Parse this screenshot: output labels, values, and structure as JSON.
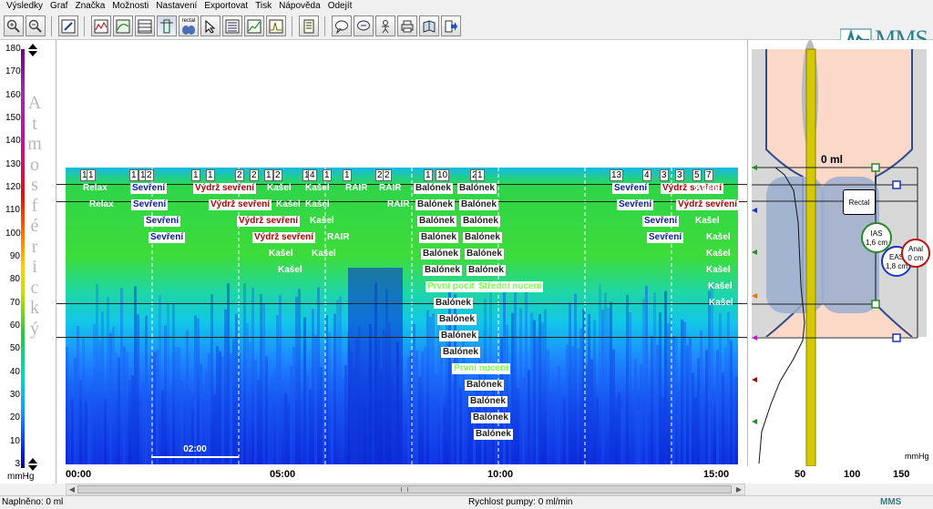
{
  "menu": [
    "Výsledky",
    "Graf",
    "Značka",
    "Možnosti",
    "Nastavení",
    "Exportovat",
    "Tisk",
    "Nápověda",
    "Odejít"
  ],
  "toolbar": {
    "buttons": [
      "zoom-in-icon",
      "zoom-out-icon",
      "edit-icon",
      "waveform-icon",
      "curve-icon",
      "table-icon",
      "ruler-icon",
      "rectal-icon",
      "pointer-icon",
      "list-icon",
      "chart-icon",
      "chart-alt-icon",
      "document-icon",
      "comment-icon",
      "comment-alt-icon",
      "figure-icon",
      "print-icon",
      "book-icon",
      "export-icon"
    ],
    "rectal_label": "rectal"
  },
  "logo": {
    "text": "MMS"
  },
  "yaxis": {
    "ticks": [
      "180",
      "170",
      "160",
      "150",
      "140",
      "130",
      "120",
      "110",
      "100",
      "90",
      "80",
      "70",
      "60",
      "50",
      "40",
      "30",
      "20",
      "10",
      "3"
    ],
    "title_letters": [
      "A",
      "t",
      "m",
      "o",
      "s",
      "f",
      "é",
      "r",
      "i",
      "c",
      "k",
      "ý"
    ],
    "unit": "mmHg"
  },
  "plot": {
    "scale_bar": "02:00",
    "value_label": "0 ml",
    "markers": [
      {
        "t": "1",
        "x": 16,
        "y": 142
      },
      {
        "t": "1",
        "x": 23,
        "y": 142
      },
      {
        "t": "1",
        "x": 70,
        "y": 142
      },
      {
        "t": "1",
        "x": 80,
        "y": 142
      },
      {
        "t": "2",
        "x": 87,
        "y": 142
      },
      {
        "t": "1",
        "x": 138,
        "y": 142
      },
      {
        "t": "1",
        "x": 154,
        "y": 142
      },
      {
        "t": "2",
        "x": 186,
        "y": 142
      },
      {
        "t": "2",
        "x": 202,
        "y": 142
      },
      {
        "t": "1",
        "x": 218,
        "y": 142
      },
      {
        "t": "2",
        "x": 228,
        "y": 142
      },
      {
        "t": "1",
        "x": 260,
        "y": 142
      },
      {
        "t": "4",
        "x": 266,
        "y": 142
      },
      {
        "t": "1",
        "x": 282,
        "y": 142
      },
      {
        "t": "1",
        "x": 304,
        "y": 142
      },
      {
        "t": "2",
        "x": 340,
        "y": 142
      },
      {
        "t": "2",
        "x": 348,
        "y": 142
      },
      {
        "t": "1",
        "x": 393,
        "y": 142
      },
      {
        "t": "10",
        "x": 406,
        "y": 142
      },
      {
        "t": "2",
        "x": 444,
        "y": 142
      },
      {
        "t": "1",
        "x": 450,
        "y": 142
      },
      {
        "t": "13",
        "x": 597,
        "y": 142
      },
      {
        "t": "4",
        "x": 633,
        "y": 142
      },
      {
        "t": "3",
        "x": 652,
        "y": 142
      },
      {
        "t": "3",
        "x": 669,
        "y": 142
      },
      {
        "t": "5",
        "x": 688,
        "y": 142
      },
      {
        "t": "7",
        "x": 701,
        "y": 142
      }
    ],
    "labels": [
      {
        "t": "Relax",
        "c": "white",
        "x": 17,
        "y": 157
      },
      {
        "t": "Relax",
        "c": "white",
        "x": 24,
        "y": 175
      },
      {
        "t": "Sevření",
        "c": "blue",
        "x": 71,
        "y": 157
      },
      {
        "t": "Sevření",
        "c": "blue",
        "x": 72,
        "y": 175
      },
      {
        "t": "Sevření",
        "c": "blue",
        "x": 86,
        "y": 193
      },
      {
        "t": "Sevření",
        "c": "blue",
        "x": 91,
        "y": 211
      },
      {
        "t": "Výdrž sevření",
        "c": "red",
        "x": 140,
        "y": 157
      },
      {
        "t": "Výdrž sevření",
        "c": "red",
        "x": 157,
        "y": 175
      },
      {
        "t": "Výdrž sevření",
        "c": "red",
        "x": 188,
        "y": 193
      },
      {
        "t": "Výdrž sevření",
        "c": "red",
        "x": 205,
        "y": 211
      },
      {
        "t": "Kašel",
        "c": "white",
        "x": 219,
        "y": 157
      },
      {
        "t": "Kašel",
        "c": "white",
        "x": 229,
        "y": 175
      },
      {
        "t": "Kašel",
        "c": "white",
        "x": 221,
        "y": 229
      },
      {
        "t": "Kašel",
        "c": "white",
        "x": 231,
        "y": 247
      },
      {
        "t": "Kašel",
        "c": "white",
        "x": 261,
        "y": 157
      },
      {
        "t": "Kašel",
        "c": "white",
        "x": 261,
        "y": 175
      },
      {
        "t": "Kašel",
        "c": "white",
        "x": 266,
        "y": 193
      },
      {
        "t": "Kašel",
        "c": "white",
        "x": 268,
        "y": 229
      },
      {
        "t": "RAIR",
        "c": "white",
        "x": 305,
        "y": 157
      },
      {
        "t": "RAIR",
        "c": "white",
        "x": 285,
        "y": 211
      },
      {
        "t": "RAIR",
        "c": "white",
        "x": 342,
        "y": 157
      },
      {
        "t": "RAIR",
        "c": "white",
        "x": 351,
        "y": 175
      },
      {
        "t": "Balónek",
        "c": "dark",
        "x": 382,
        "y": 157
      },
      {
        "t": "Balónek",
        "c": "dark",
        "x": 384,
        "y": 175
      },
      {
        "t": "Balónek",
        "c": "dark",
        "x": 386,
        "y": 193
      },
      {
        "t": "Balónek",
        "c": "dark",
        "x": 388,
        "y": 211
      },
      {
        "t": "Balónek",
        "c": "dark",
        "x": 390,
        "y": 229
      },
      {
        "t": "Balónek",
        "c": "dark",
        "x": 392,
        "y": 247
      },
      {
        "t": "První pocit",
        "c": "green",
        "x": 395,
        "y": 265
      },
      {
        "t": "Balónek",
        "c": "dark",
        "x": 404,
        "y": 283
      },
      {
        "t": "Balónek",
        "c": "dark",
        "x": 408,
        "y": 301
      },
      {
        "t": "Balónek",
        "c": "dark",
        "x": 410,
        "y": 319
      },
      {
        "t": "Balónek",
        "c": "dark",
        "x": 412,
        "y": 337
      },
      {
        "t": "První nucení",
        "c": "green",
        "x": 424,
        "y": 355
      },
      {
        "t": "Balónek",
        "c": "dark",
        "x": 438,
        "y": 373
      },
      {
        "t": "Balónek",
        "c": "dark",
        "x": 442,
        "y": 391
      },
      {
        "t": "Balónek",
        "c": "dark",
        "x": 445,
        "y": 409
      },
      {
        "t": "Balónek",
        "c": "dark",
        "x": 448,
        "y": 427
      },
      {
        "t": "Balónek",
        "c": "dark",
        "x": 430,
        "y": 157
      },
      {
        "t": "Balónek",
        "c": "dark",
        "x": 432,
        "y": 175
      },
      {
        "t": "Balónek",
        "c": "dark",
        "x": 434,
        "y": 193
      },
      {
        "t": "Balónek",
        "c": "dark",
        "x": 436,
        "y": 211
      },
      {
        "t": "Balónek",
        "c": "dark",
        "x": 438,
        "y": 229
      },
      {
        "t": "Balónek",
        "c": "dark",
        "x": 440,
        "y": 247
      },
      {
        "t": "Střední nucení",
        "c": "green",
        "x": 451,
        "y": 265
      },
      {
        "t": "Sevření",
        "c": "blue",
        "x": 600,
        "y": 157
      },
      {
        "t": "Sevření",
        "c": "blue",
        "x": 605,
        "y": 175
      },
      {
        "t": "Sevření",
        "c": "blue",
        "x": 633,
        "y": 193
      },
      {
        "t": "Sevření",
        "c": "blue",
        "x": 638,
        "y": 211
      },
      {
        "t": "Výdrž sevření",
        "c": "red",
        "x": 653,
        "y": 157
      },
      {
        "t": "Výdrž sevření",
        "c": "red",
        "x": 670,
        "y": 175
      },
      {
        "t": "Kašel",
        "c": "white",
        "x": 689,
        "y": 157
      },
      {
        "t": "Kašel",
        "c": "white",
        "x": 689,
        "y": 193
      },
      {
        "t": "Kašel",
        "c": "white",
        "x": 701,
        "y": 211
      },
      {
        "t": "Kašel",
        "c": "white",
        "x": 701,
        "y": 229
      },
      {
        "t": "Kašel",
        "c": "white",
        "x": 701,
        "y": 247
      },
      {
        "t": "Kašel",
        "c": "white",
        "x": 703,
        "y": 265
      },
      {
        "t": "Kašel",
        "c": "white",
        "x": 704,
        "y": 283
      }
    ]
  },
  "time_axis": [
    "00:00",
    "05:00",
    "10:00",
    "15:00"
  ],
  "right_panel": {
    "rectal_label": "Rectal",
    "ias_label": "IAS",
    "ias_value": "1,6 cm",
    "eas_label": "EAS",
    "eas_value": "1,8 cm",
    "anal_label": "Anal",
    "anal_value": "0 cm",
    "unit": "mmHg",
    "xticks": [
      "50",
      "100",
      "150"
    ]
  },
  "status": {
    "fill": "Naplněno: 0 ml",
    "pump": "Rychlost pumpy: 0 ml/min"
  },
  "colors": {
    "colorbar": [
      "#6a0080",
      "#e01010",
      "#ffd000",
      "#27c93f",
      "#00d8c0",
      "#0022ee"
    ],
    "logo": "#2a7f8f"
  }
}
